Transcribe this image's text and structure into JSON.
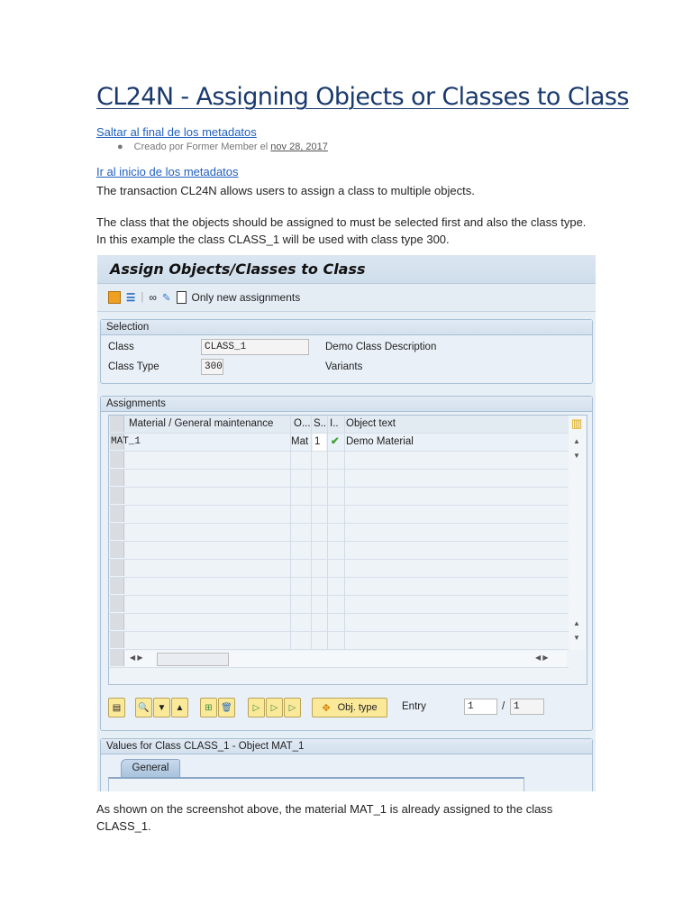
{
  "page": {
    "title": "CL24N - Assigning Objects or Classes to Class",
    "skip_link": "Saltar al final de los metadatos",
    "created_prefix": "Creado por Former Member el",
    "created_date": "nov 28, 2017",
    "top_link": "Ir al inicio de los metadatos",
    "para1": "The transaction CL24N allows users to assign a class to multiple objects.",
    "para2": "The class that the objects should be assigned to must be selected first and also the class type.",
    "para3": "In this example the class CLASS_1 will be used with class type 300.",
    "para4": "As shown on the screenshot above, the material MAT_1 is already assigned to the class",
    "para5": "CLASS_1."
  },
  "sap": {
    "title": "Assign Objects/Classes to Class",
    "toolbar": {
      "only_new": "Only new assignments"
    },
    "selection": {
      "header": "Selection",
      "class_label": "Class",
      "class_value": "CLASS_1",
      "class_desc": "Demo Class Description",
      "type_label": "Class Type",
      "type_value": "300",
      "type_desc": "Variants"
    },
    "assignments": {
      "header": "Assignments",
      "columns": [
        "Material / General maintenance",
        "O...",
        "S..",
        "I..",
        "Object text"
      ],
      "rows": [
        {
          "material": "MAT_1",
          "o": "Mat",
          "s": "1",
          "status": "check",
          "text": "Demo Material"
        }
      ],
      "obj_type": "Obj. type",
      "entry_label": "Entry",
      "entry_value": "1",
      "entry_sep": "/",
      "entry_total": "1"
    },
    "values": {
      "header": "Values for Class CLASS_1 - Object MAT_1",
      "tab": "General"
    }
  }
}
